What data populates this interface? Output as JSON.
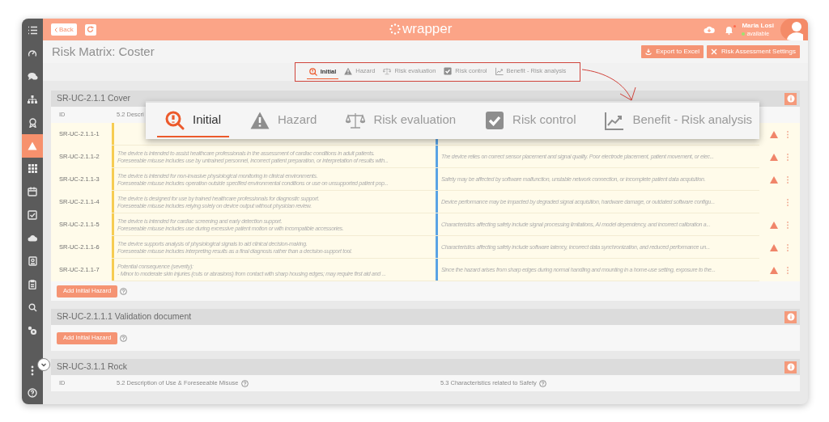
{
  "sidebar": {
    "items": [
      {
        "selected": false
      },
      {
        "selected": false
      },
      {
        "selected": false
      },
      {
        "selected": false
      },
      {
        "selected": false
      },
      {
        "selected": true
      },
      {
        "selected": false
      },
      {
        "selected": false
      },
      {
        "selected": false
      },
      {
        "selected": false
      },
      {
        "selected": false
      },
      {
        "selected": false
      },
      {
        "selected": false
      },
      {
        "selected": false
      }
    ],
    "bottom_items": [
      {
        "selected": false
      },
      {
        "selected": false
      }
    ]
  },
  "top_bar": {
    "back_label": "Back",
    "logo": "wrapper",
    "user_name": "Maria Losi",
    "user_status": "available",
    "notifications": true
  },
  "page": {
    "title": "Risk Matrix: Coster",
    "actions": [
      "Export to Excel",
      "Risk Assessment Settings"
    ]
  },
  "tab_bar": {
    "tabs": [
      {
        "label": "Initial",
        "selected": true
      },
      {
        "label": "Hazard",
        "selected": false
      },
      {
        "label": "Risk evaluation",
        "selected": false
      },
      {
        "label": "Risk control",
        "selected": false
      },
      {
        "label": "Benefit - Risk analysis",
        "selected": false
      }
    ]
  },
  "zoom_callout": {
    "tabs": [
      {
        "label": "Initial",
        "selected": true
      },
      {
        "label": "Hazard",
        "selected": false
      },
      {
        "label": "Risk evaluation",
        "selected": false
      },
      {
        "label": "Risk control",
        "selected": false
      },
      {
        "label": "Benefit - Risk analysis",
        "selected": false
      }
    ]
  },
  "sections": [
    {
      "title": "SR-UC-2.1.1 Cover",
      "columns": [
        {
          "label": "ID",
          "help": false
        },
        {
          "label": "5.2 Descri"
        }
      ],
      "rows": [
        {
          "id": "SR-UC-2.1.1-1",
          "warning": true
        },
        {
          "id": "SR-UC-2.1.1-2",
          "description": [
            "The device is intended to assist healthcare professionals in the assessment of cardiac conditions in adult patients.",
            "Foreseeable misuse includes use by untrained personnel, incorrect patient preparation, or interpretation of results with..."
          ],
          "characteristics": [
            "The device relies on correct sensor placement and signal quality. Poor electrode placement, patient movement, or elec..."
          ],
          "warning": true
        },
        {
          "id": "SR-UC-2.1.1-3",
          "description": [
            "The device is intended for non-invasive physiological monitoring in clinical environments.",
            "Foreseeable misuse includes operation outside specified environmental conditions or use on unsupported patient pop..."
          ],
          "characteristics": [
            "Safety may be affected by software malfunction, unstable network connection, or incomplete patient data acquisition."
          ],
          "warning": true
        },
        {
          "id": "SR-UC-2.1.1-4",
          "description": [
            "The device is designed for use by trained healthcare professionals for diagnostic support.",
            "Foreseeable misuse includes relying solely on device output without physician review."
          ],
          "characteristics": [
            "Device performance may be impacted by degraded signal acquisition, hardware damage, or outdated software configu..."
          ],
          "warning": false
        },
        {
          "id": "SR-UC-2.1.1-5",
          "description": [
            "The device is intended for cardiac screening and early detection support.",
            "Foreseeable misuse includes use during excessive patient motion or with incompatible accessories."
          ],
          "characteristics": [
            "Characteristics affecting safety include signal processing limitations, AI model dependency, and incorrect calibration a..."
          ],
          "warning": true
        },
        {
          "id": "SR-UC-2.1.1-6",
          "description": [
            "The device supports analysis of physiological signals to aid clinical decision-making.",
            "Foreseeable misuse includes interpreting results as a final diagnosis rather than a decision-support tool."
          ],
          "characteristics": [
            "Characteristics affecting safety include software latency, incorrect data synchronization, and reduced performance un..."
          ],
          "warning": true
        },
        {
          "id": "SR-UC-2.1.1-7",
          "description": [
            "Potential consequence (severity):",
            "- Minor to moderate skin injuries (cuts or abrasions) from contact with sharp housing edges; may require first aid and ..."
          ],
          "characteristics": [
            "Since the hazard arises from sharp edges during normal handling and mounting in a home-use setting, exposure to the..."
          ],
          "warning": true
        }
      ],
      "add_button": "Add Initial Hazard"
    },
    {
      "title": "SR-UC-2.1.1.1 Validation document",
      "add_button": "Add Initial Hazard"
    },
    {
      "title": "SR-UC-3.1.1 Rock",
      "columns": [
        {
          "label": "ID",
          "help": false
        },
        {
          "label": "5.2 Description of Use & Foreseeable Misuse",
          "help": true
        },
        {
          "label": "5.3 Characteristics related to Safety",
          "help": true
        }
      ]
    }
  ]
}
